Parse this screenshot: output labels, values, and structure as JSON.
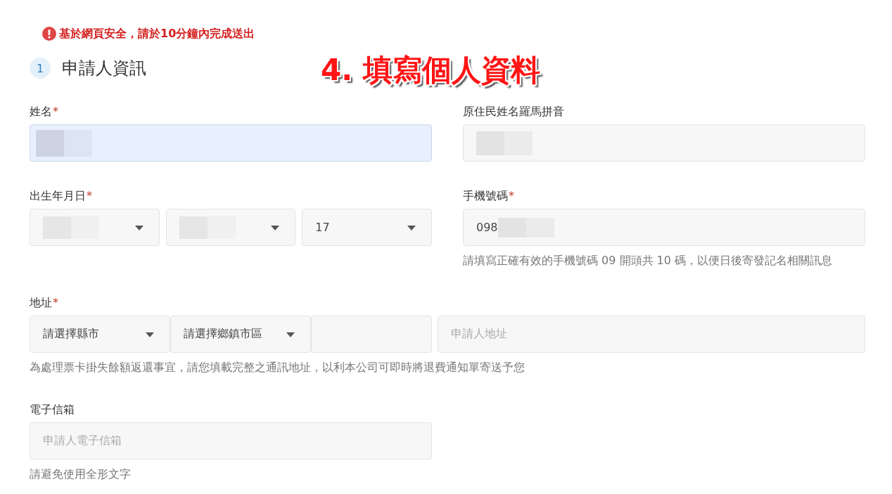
{
  "notice": "基於網頁安全，請於10分鐘內完成送出",
  "section": {
    "step": "1",
    "title": "申請人資訊"
  },
  "annotation": "4. 填寫個人資料",
  "rows": [
    {
      "fields": [
        {
          "kind": "text",
          "label": "姓名",
          "required_mark": "*",
          "controls": [
            {
              "kind": "input",
              "autofilled": true,
              "masked": true
            }
          ]
        },
        {
          "kind": "text",
          "label": "原住民姓名羅馬拼音",
          "controls": [
            {
              "kind": "input",
              "masked": true
            }
          ]
        }
      ]
    },
    {
      "fields": [
        {
          "kind": "date",
          "label": "出生年月日",
          "required_mark": "*",
          "controls": [
            {
              "kind": "select",
              "masked": true
            },
            {
              "kind": "select",
              "masked": true
            },
            {
              "kind": "select",
              "value": "17"
            }
          ]
        },
        {
          "kind": "text",
          "label": "手機號碼",
          "required_mark": "*",
          "controls": [
            {
              "kind": "input",
              "value": "098",
              "masked": true
            }
          ],
          "help": "請填寫正確有效的手機號碼 09 開頭共 10 碼，以便日後寄發記名相關訊息"
        }
      ]
    },
    {
      "fields": [
        {
          "kind": "address",
          "label": "地址",
          "required_mark": "*",
          "controls": [
            {
              "kind": "select",
              "value": "請選擇縣市"
            },
            {
              "kind": "select",
              "value": "請選擇鄉鎮市區"
            },
            {
              "kind": "input"
            },
            {
              "kind": "input",
              "placeholder": "申請人地址"
            }
          ],
          "help": "為處理票卡掛失餘額返還事宜，請您填載完整之通訊地址，以利本公司可即時將退費通知單寄送予您"
        }
      ]
    },
    {
      "fields": [
        {
          "kind": "text",
          "label": "電子信箱",
          "controls": [
            {
              "kind": "input",
              "placeholder": "申請人電子信箱"
            }
          ],
          "help": "請避免使用全形文字"
        }
      ]
    }
  ]
}
